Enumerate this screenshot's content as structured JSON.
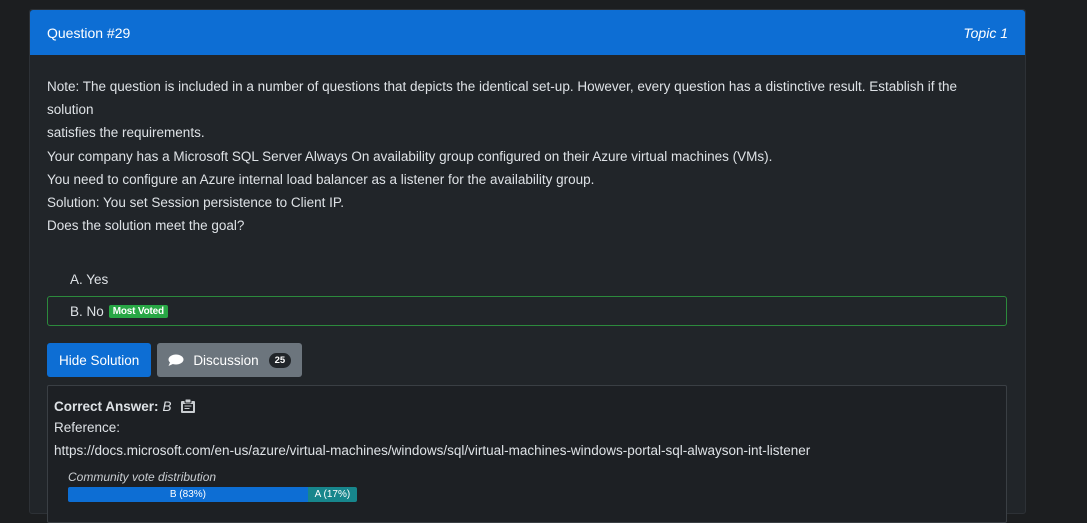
{
  "header": {
    "question_number": "Question #29",
    "topic": "Topic 1"
  },
  "question": {
    "lines": [
      "Note: The question is included in a number of questions that depicts the identical set-up. However, every question has a distinctive result. Establish if the solution",
      "satisfies the requirements.",
      "Your company has a Microsoft SQL Server Always On availability group configured on their Azure virtual machines (VMs).",
      "You need to configure an Azure internal load balancer as a listener for the availability group.",
      "Solution: You set Session persistence to Client IP.",
      "Does the solution meet the goal?"
    ]
  },
  "choices": [
    {
      "label": "A. Yes",
      "voted": false,
      "badge": ""
    },
    {
      "label": "B. No",
      "voted": true,
      "badge": "Most Voted"
    }
  ],
  "buttons": {
    "hide_solution": "Hide Solution",
    "discussion": "Discussion",
    "discussion_count": "25"
  },
  "answer": {
    "label": "Correct Answer:",
    "value": "B",
    "reference_label": "Reference:",
    "reference_url": "https://docs.microsoft.com/en-us/azure/virtual-machines/windows/sql/virtual-machines-windows-portal-sql-alwayson-int-listener"
  },
  "community": {
    "label": "Community vote distribution",
    "votes": [
      {
        "label": "B (83%)",
        "percent": 83,
        "color": "#0d6ed4"
      },
      {
        "label": "A (17%)",
        "percent": 17,
        "color": "#17868c"
      }
    ]
  },
  "colors": {
    "header_bg": "#0d6ed4",
    "most_voted_badge": "#28a745",
    "voted_border": "#2c8a3c"
  },
  "icons": {
    "discussion": "speech-bubble-icon",
    "answer": "clipboard-icon"
  }
}
